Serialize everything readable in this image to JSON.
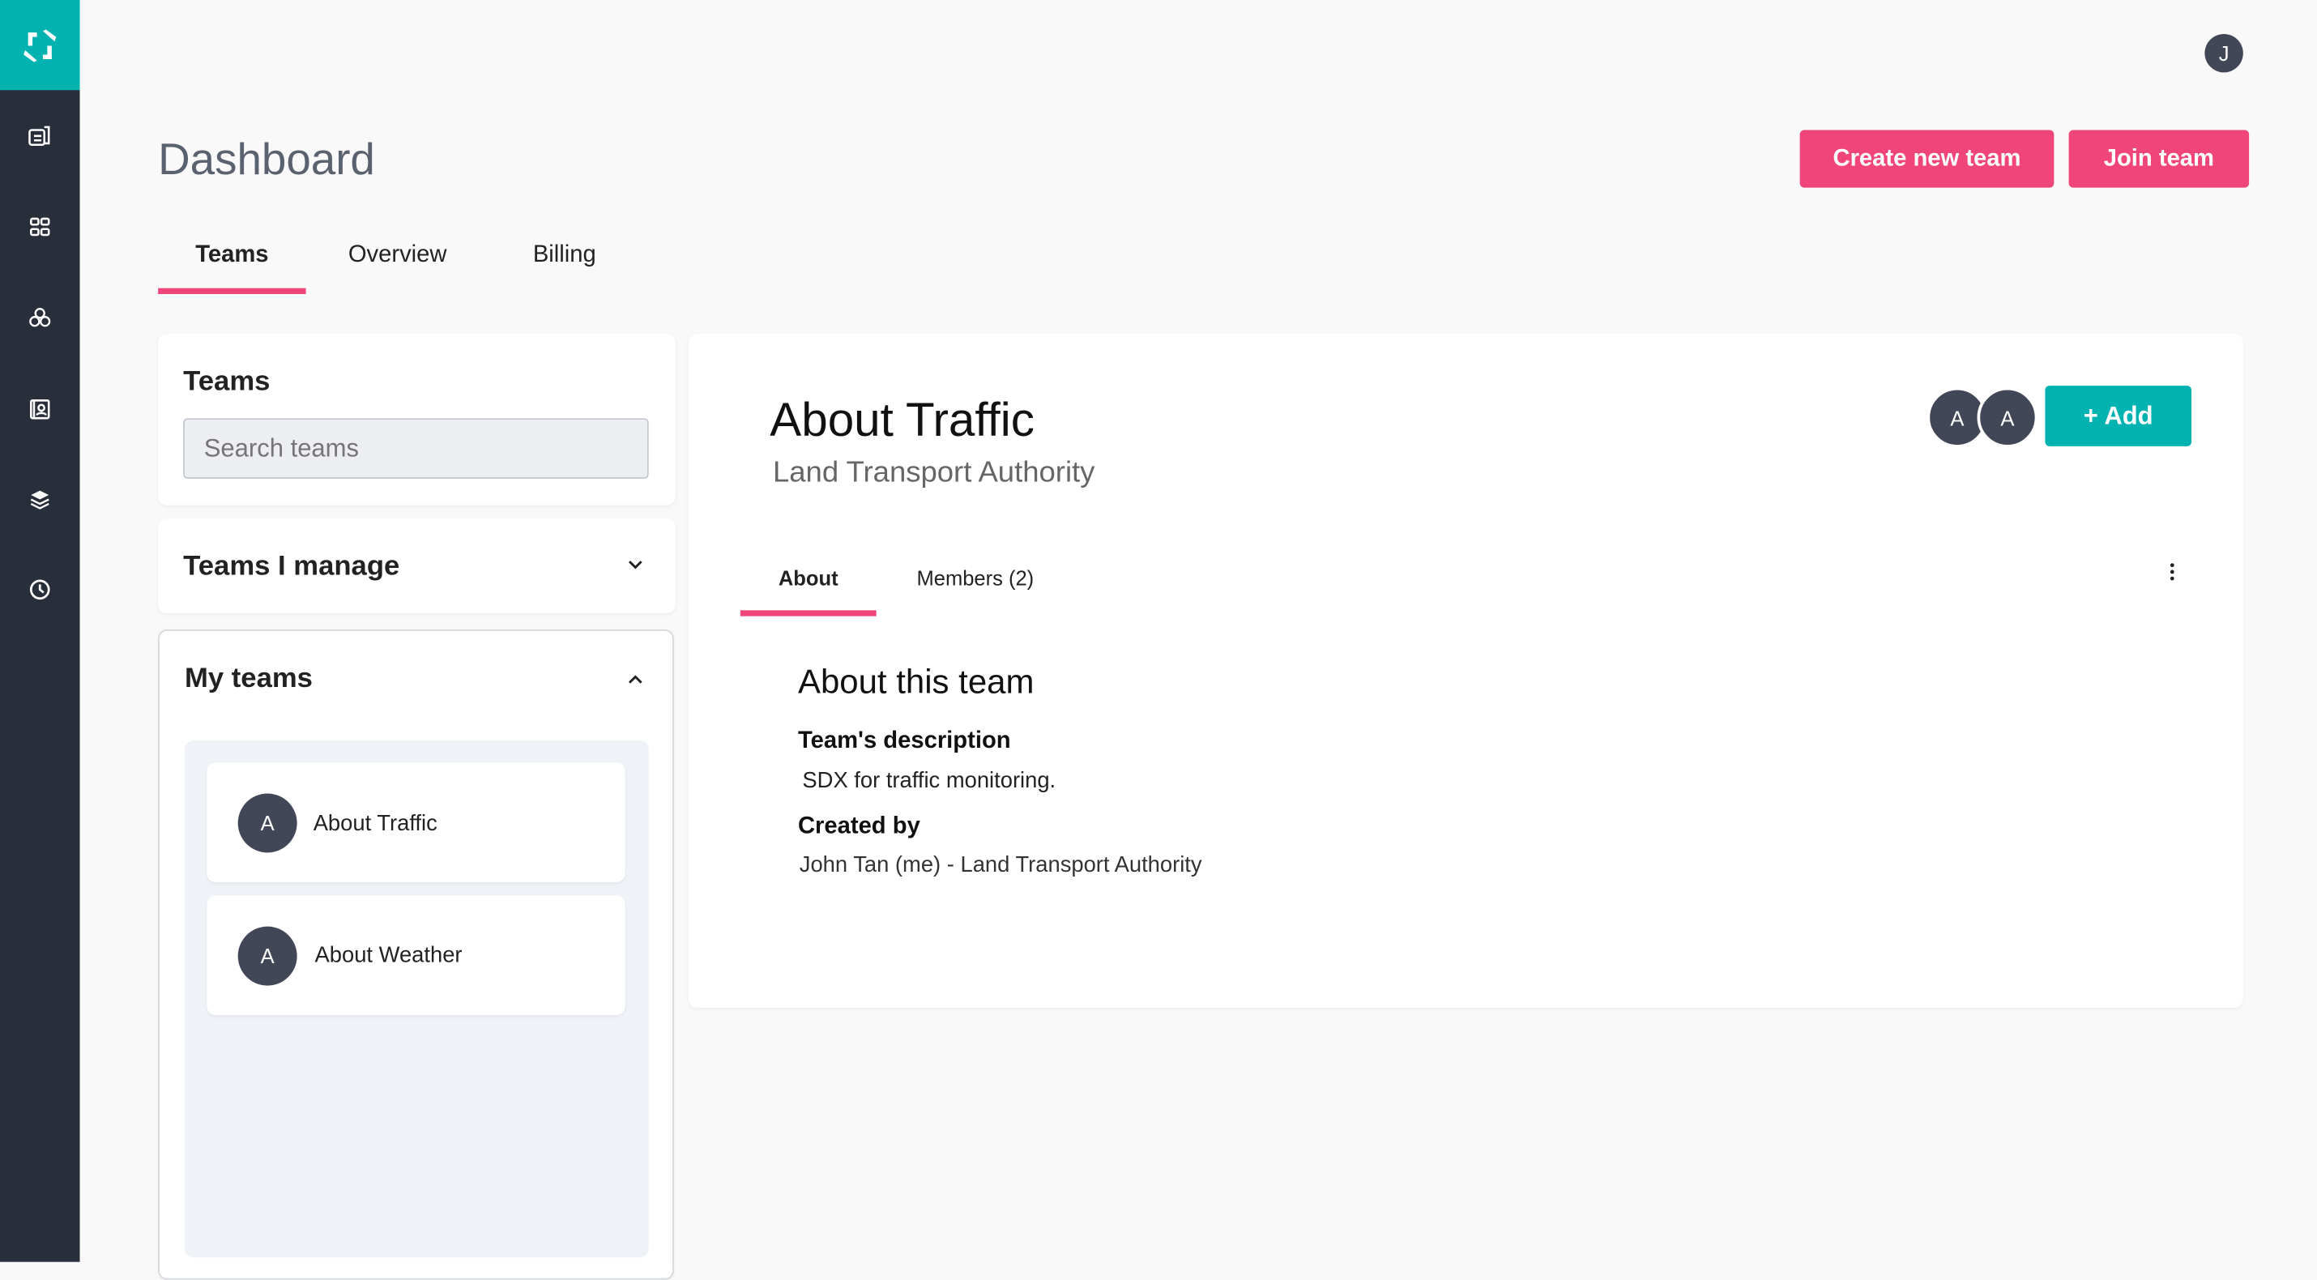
{
  "sidebar": {
    "items": [
      "news-icon",
      "grid-icon",
      "circles-icon",
      "contact-card-icon",
      "layers-icon",
      "clock-icon"
    ]
  },
  "user": {
    "initial": "J"
  },
  "header": {
    "title": "Dashboard",
    "create_label": "Create new team",
    "join_label": "Join team"
  },
  "tabs": [
    {
      "label": "Teams",
      "active": true
    },
    {
      "label": "Overview"
    },
    {
      "label": "Billing"
    }
  ],
  "left": {
    "teams_title": "Teams",
    "search_placeholder": "Search teams",
    "manage_title": "Teams I manage",
    "my_teams_title": "My teams",
    "my_teams": [
      {
        "initial": "A",
        "name": "About Traffic"
      },
      {
        "initial": "A",
        "name": "About Weather"
      }
    ]
  },
  "detail": {
    "title": "About Traffic",
    "org": "Land Transport Authority",
    "member_initials": [
      "A",
      "A"
    ],
    "add_label": "+ Add",
    "tabs": [
      {
        "label": "About",
        "active": true
      },
      {
        "label": "Members (2)"
      }
    ],
    "section_title": "About this team",
    "desc_label": "Team's description",
    "desc": "SDX for traffic monitoring.",
    "created_label": "Created by",
    "created": "John Tan (me) - Land Transport Authority"
  },
  "colors": {
    "accent": "#f0457a",
    "teal": "#00b3b0",
    "sidebar": "#282f3b"
  }
}
